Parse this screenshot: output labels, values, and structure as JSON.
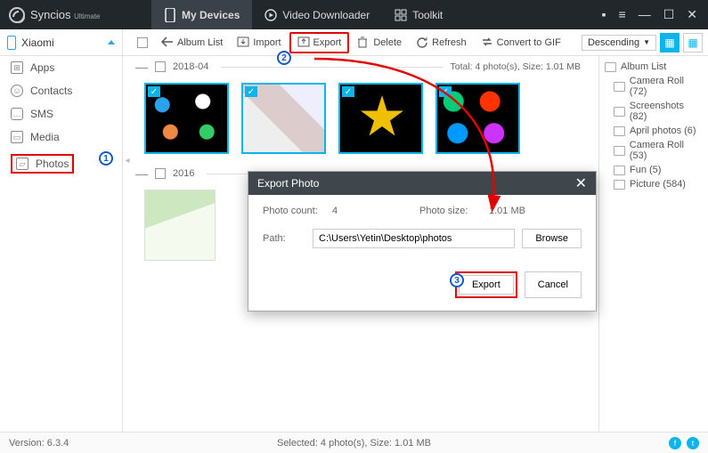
{
  "app": {
    "name": "Syncios",
    "edition": "Ultimate"
  },
  "tabs": {
    "my_devices": "My Devices",
    "video_downloader": "Video Downloader",
    "toolkit": "Toolkit"
  },
  "device": "Xiaomi",
  "toolbar": {
    "album_list": "Album List",
    "import": "Import",
    "export": "Export",
    "delete": "Delete",
    "refresh": "Refresh",
    "convert_gif": "Convert to GIF",
    "sort": "Descending"
  },
  "sidebar": {
    "apps": "Apps",
    "contacts": "Contacts",
    "sms": "SMS",
    "media": "Media",
    "photos": "Photos"
  },
  "groups": {
    "g1": {
      "label": "2018-04",
      "total": "Total: 4 photo(s), Size: 1.01 MB"
    },
    "g2": {
      "label": "2016"
    }
  },
  "albums": {
    "header": "Album List",
    "items": [
      "Camera Roll (72)",
      "Screenshots (82)",
      "April photos (6)",
      "Camera Roll (53)",
      "Fun (5)",
      "Picture (584)"
    ]
  },
  "dialog": {
    "title": "Export Photo",
    "count_label": "Photo count:",
    "count_value": "4",
    "size_label": "Photo size:",
    "size_value": "1.01 MB",
    "path_label": "Path:",
    "path_value": "C:\\Users\\Yetin\\Desktop\\photos",
    "browse": "Browse",
    "export": "Export",
    "cancel": "Cancel"
  },
  "status": {
    "version": "Version: 6.3.4",
    "selected": "Selected: 4 photo(s), Size: 1.01 MB"
  },
  "annotations": {
    "n1": "1",
    "n2": "2",
    "n3": "3"
  }
}
